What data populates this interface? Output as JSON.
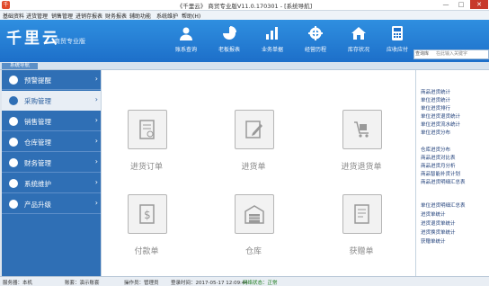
{
  "window": {
    "title": "《千里云》 商贸专业版V11.0.170301 - [系统导航]",
    "app_icon_text": "千"
  },
  "menu": [
    "基础资料",
    "进货管理",
    "销售管理",
    "进销存报表",
    "财务报表",
    "辅助功能",
    "系统维护",
    "帮助(H)"
  ],
  "brand": {
    "name": "千里云",
    "subtitle": "商贸专业版"
  },
  "toolbar": [
    {
      "label": "账系查询",
      "icon": "person-icon"
    },
    {
      "label": "老板报表",
      "icon": "pie-chart-icon"
    },
    {
      "label": "业务单据",
      "icon": "bar-chart-icon"
    },
    {
      "label": "经营历程",
      "icon": "gear-icon"
    },
    {
      "label": "库存状况",
      "icon": "home-icon"
    },
    {
      "label": "应收应付",
      "icon": "calculator-icon"
    }
  ],
  "search": {
    "scope": "查询库",
    "placeholder": "在此输入关键字"
  },
  "tab": {
    "label": "系统导航"
  },
  "sidebar": [
    {
      "label": "预警提醒",
      "icon": "info-icon"
    },
    {
      "label": "采购管理",
      "icon": "cart-icon",
      "active": true
    },
    {
      "label": "销售管理",
      "icon": "shop-icon"
    },
    {
      "label": "仓库管理",
      "icon": "warehouse-icon"
    },
    {
      "label": "财务管理",
      "icon": "money-icon"
    },
    {
      "label": "系统维护",
      "icon": "wrench-icon"
    },
    {
      "label": "产品升级",
      "icon": "upgrade-icon"
    }
  ],
  "cards": [
    {
      "label": "进货订单",
      "icon": "order-doc-icon"
    },
    {
      "label": "进货单",
      "icon": "edit-doc-icon"
    },
    {
      "label": "进货退货单",
      "icon": "return-cart-icon"
    },
    {
      "label": "付款单",
      "icon": "payment-doc-icon"
    },
    {
      "label": "仓库",
      "icon": "warehouse-icon"
    },
    {
      "label": "获赠单",
      "icon": "gift-doc-icon"
    }
  ],
  "reports": [
    "商品进货统计",
    "单位进货统计",
    "单位进货排行",
    "单位进货退货统计",
    "单位进货流水统计",
    "单位进货分布",
    "仓库进货分布",
    "商品进货对比表",
    "商品进货月分析",
    "商品智能补货计划",
    "商品进货明细汇总表",
    "单位进货明细汇总表",
    "进货单统计",
    "进货退货单统计",
    "进货换货单统计",
    "获赠单统计"
  ],
  "status": {
    "company": "服务器：本机",
    "user": "账套：演示账套",
    "operator": "操作员：管理员",
    "time": "登录时间：2017-05-17 12:09:44",
    "network": "网络状态：正常"
  },
  "colors": {
    "banner": "#1d6fc9",
    "sidebar": "#2f6fb5",
    "close": "#c7392b"
  }
}
